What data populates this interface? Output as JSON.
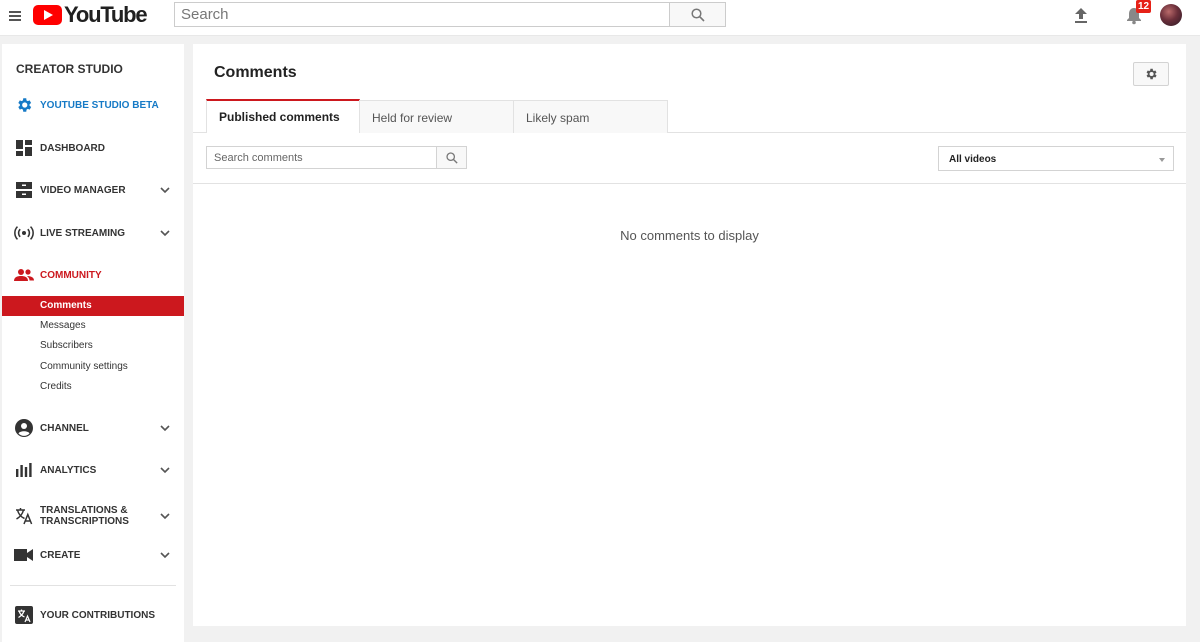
{
  "topbar": {
    "logo_text": "YouTube",
    "search_placeholder": "Search",
    "notification_count": "12"
  },
  "sidebar": {
    "title": "CREATOR STUDIO",
    "items": {
      "studio_beta": "YOUTUBE STUDIO BETA",
      "dashboard": "DASHBOARD",
      "video_manager": "VIDEO MANAGER",
      "live_streaming": "LIVE STREAMING",
      "community": "COMMUNITY",
      "channel": "CHANNEL",
      "analytics": "ANALYTICS",
      "translations_line1": "TRANSLATIONS &",
      "translations_line2": "TRANSCRIPTIONS",
      "create": "CREATE",
      "contributions": "YOUR CONTRIBUTIONS"
    },
    "community_sub": [
      "Comments",
      "Messages",
      "Subscribers",
      "Community settings",
      "Credits"
    ]
  },
  "main": {
    "title": "Comments",
    "tabs": [
      "Published comments",
      "Held for review",
      "Likely spam"
    ],
    "search_placeholder": "Search comments",
    "video_filter": "All videos",
    "empty_message": "No comments to display"
  },
  "colors": {
    "brand_red": "#ff0000",
    "active_red": "#cc181e",
    "link_blue": "#167ac6"
  }
}
